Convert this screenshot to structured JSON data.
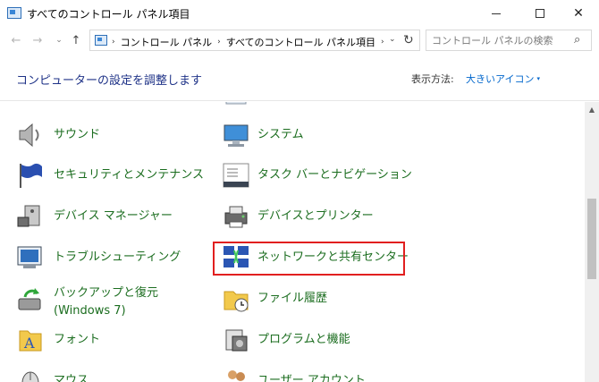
{
  "window": {
    "title": "すべてのコントロール パネル項目",
    "controls": {
      "minimize": "minimize",
      "maximize": "maximize",
      "close": "✕"
    }
  },
  "navigation": {
    "back": "←",
    "forward": "→",
    "recent": "⌄",
    "up": "↑",
    "breadcrumb": [
      "コントロール パネル",
      "すべてのコントロール パネル項目"
    ],
    "separator": "›",
    "dropdown": "⌄",
    "refresh": "↻",
    "search_placeholder": "コントロール パネルの検索",
    "search_icon": "⌕"
  },
  "header": {
    "heading": "コンピューターの設定を調整します",
    "view_label": "表示方法:",
    "view_value": "大きいアイコン",
    "view_caret": "▾"
  },
  "items": {
    "cutoff_top": "ー",
    "sound": "サウンド",
    "system": "システム",
    "security": "セキュリティとメンテナンス",
    "taskbar": "タスク バーとナビゲーション",
    "device_manager": "デバイス マネージャー",
    "devices_printers": "デバイスとプリンター",
    "troubleshooting": "トラブルシューティング",
    "network_center": "ネットワークと共有センター",
    "backup_line1": "バックアップと復元",
    "backup_line2": "(Windows 7)",
    "file_history": "ファイル履歴",
    "fonts": "フォント",
    "programs": "プログラムと機能",
    "mouse": "マウス",
    "user_accounts": "ユーザー アカウント"
  },
  "icons": {
    "app": "control-panel-icon",
    "sound": "speaker-icon",
    "system": "monitor-icon",
    "security": "flag-icon",
    "taskbar": "taskbar-icon",
    "device_manager": "device-manager-icon",
    "devices_printers": "printer-icon",
    "troubleshooting": "troubleshoot-icon",
    "network": "network-icon",
    "backup": "backup-icon",
    "file_history": "folder-clock-icon",
    "fonts": "font-folder-icon",
    "programs": "programs-icon",
    "mouse": "mouse-icon",
    "user_accounts": "users-icon"
  },
  "colors": {
    "item_text": "#1b6d1f",
    "heading": "#1e3287",
    "link": "#0066cc",
    "highlight_box": "#e11f1f"
  }
}
